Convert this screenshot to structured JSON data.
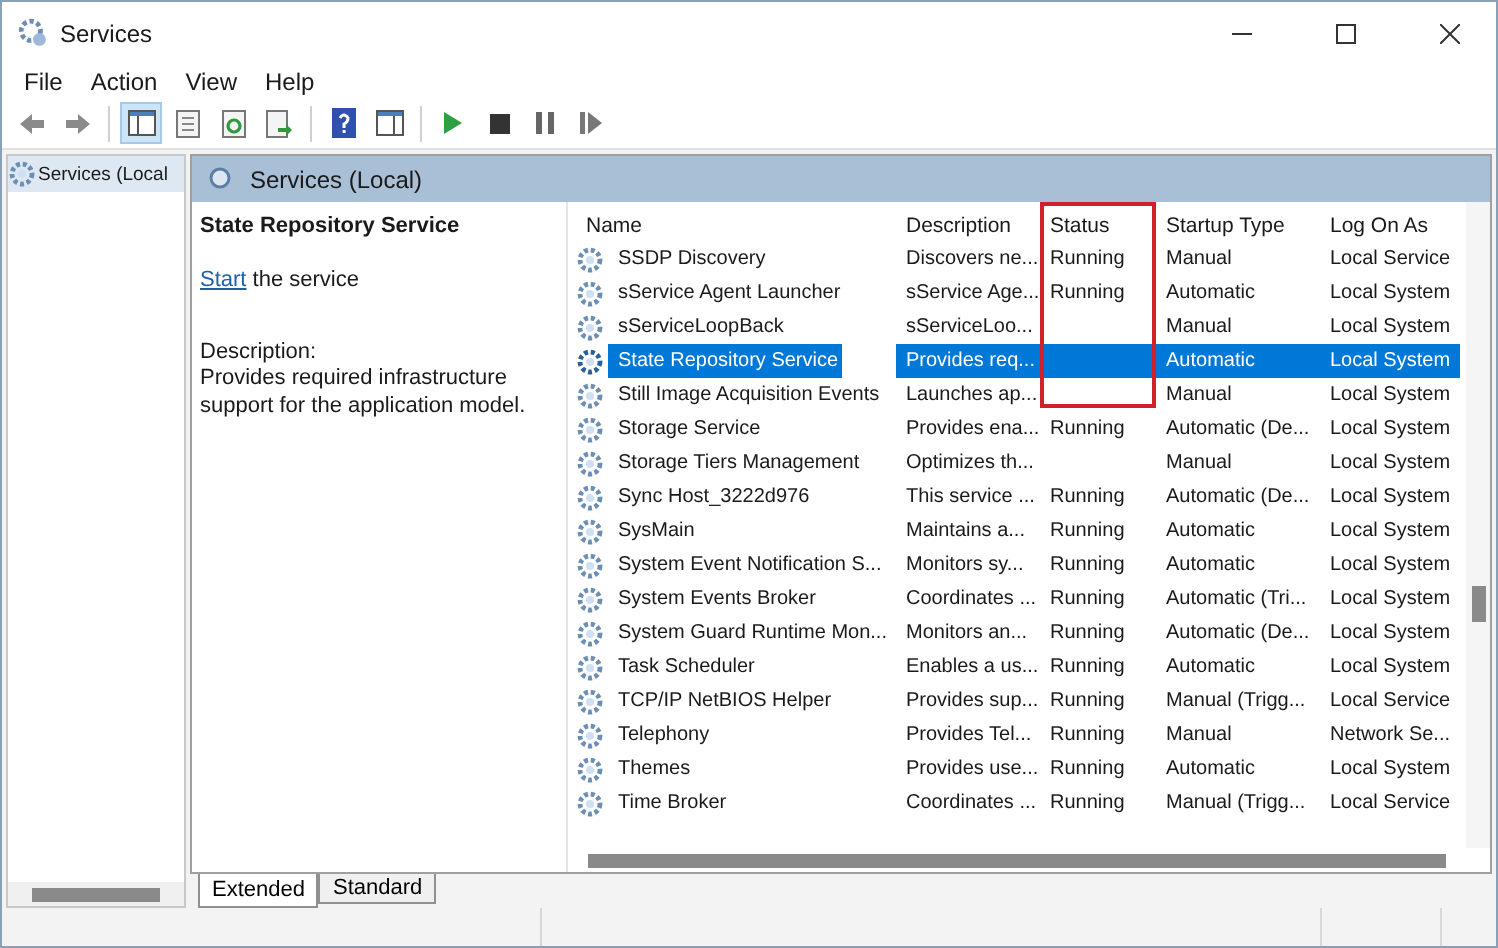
{
  "window": {
    "title": "Services"
  },
  "menu": [
    "File",
    "Action",
    "View",
    "Help"
  ],
  "toolbar": [
    {
      "kind": "back",
      "selected": false
    },
    {
      "kind": "forward",
      "selected": false
    },
    {
      "kind": "tree",
      "selected": true
    },
    {
      "kind": "properties",
      "selected": false
    },
    {
      "kind": "refresh",
      "selected": false
    },
    {
      "kind": "export",
      "selected": false
    },
    {
      "kind": "help",
      "selected": false
    },
    {
      "kind": "pane",
      "selected": false
    },
    {
      "kind": "play",
      "selected": false
    },
    {
      "kind": "stop",
      "selected": false
    },
    {
      "kind": "pause",
      "selected": false
    },
    {
      "kind": "resume",
      "selected": false
    }
  ],
  "tree": {
    "items": [
      {
        "label": "Services (Local",
        "selected": true
      }
    ]
  },
  "panel": {
    "title": "Services (Local)"
  },
  "details": {
    "name": "State Repository Service",
    "action_link": "Start",
    "action_text": " the service",
    "description_label": "Description:",
    "description": "Provides required infrastructure support for the application model."
  },
  "table": {
    "columns": [
      {
        "label": "Name",
        "highlighted": false
      },
      {
        "label": "Description",
        "highlighted": false
      },
      {
        "label": "Status",
        "highlighted": true
      },
      {
        "label": "Startup Type",
        "highlighted": false
      },
      {
        "label": "Log On As",
        "highlighted": false
      }
    ],
    "rows": [
      {
        "cells": [
          "SSDP Discovery",
          "Discovers ne...",
          "Running",
          "Manual",
          "Local Service"
        ],
        "selected": false
      },
      {
        "cells": [
          "sService Agent Launcher",
          "sService Age...",
          "Running",
          "Automatic",
          "Local System"
        ],
        "selected": false
      },
      {
        "cells": [
          "sServiceLoopBack",
          "sServiceLoo...",
          "",
          "Manual",
          "Local System"
        ],
        "selected": false
      },
      {
        "cells": [
          "State Repository Service",
          "Provides req...",
          "",
          "Automatic",
          "Local System"
        ],
        "selected": true
      },
      {
        "cells": [
          "Still Image Acquisition Events",
          "Launches ap...",
          "",
          "Manual",
          "Local System"
        ],
        "selected": false
      },
      {
        "cells": [
          "Storage Service",
          "Provides ena...",
          "Running",
          "Automatic (De...",
          "Local System"
        ],
        "selected": false
      },
      {
        "cells": [
          "Storage Tiers Management",
          "Optimizes th...",
          "",
          "Manual",
          "Local System"
        ],
        "selected": false
      },
      {
        "cells": [
          "Sync Host_3222d976",
          "This service ...",
          "Running",
          "Automatic (De...",
          "Local System"
        ],
        "selected": false
      },
      {
        "cells": [
          "SysMain",
          "Maintains a...",
          "Running",
          "Automatic",
          "Local System"
        ],
        "selected": false
      },
      {
        "cells": [
          "System Event Notification S...",
          "Monitors sy...",
          "Running",
          "Automatic",
          "Local System"
        ],
        "selected": false
      },
      {
        "cells": [
          "System Events Broker",
          "Coordinates ...",
          "Running",
          "Automatic (Tri...",
          "Local System"
        ],
        "selected": false
      },
      {
        "cells": [
          "System Guard Runtime Mon...",
          "Monitors an...",
          "Running",
          "Automatic (De...",
          "Local System"
        ],
        "selected": false
      },
      {
        "cells": [
          "Task Scheduler",
          "Enables a us...",
          "Running",
          "Automatic",
          "Local System"
        ],
        "selected": false
      },
      {
        "cells": [
          "TCP/IP NetBIOS Helper",
          "Provides sup...",
          "Running",
          "Manual (Trigg...",
          "Local Service"
        ],
        "selected": false
      },
      {
        "cells": [
          "Telephony",
          "Provides Tel...",
          "Running",
          "Manual",
          "Network Se..."
        ],
        "selected": false
      },
      {
        "cells": [
          "Themes",
          "Provides use...",
          "Running",
          "Automatic",
          "Local System"
        ],
        "selected": false
      },
      {
        "cells": [
          "Time Broker",
          "Coordinates ...",
          "Running",
          "Manual (Trigg...",
          "Local Service"
        ],
        "selected": false
      }
    ]
  },
  "view_tabs": [
    {
      "label": "Extended",
      "selected": true
    },
    {
      "label": "Standard",
      "selected": false
    }
  ]
}
